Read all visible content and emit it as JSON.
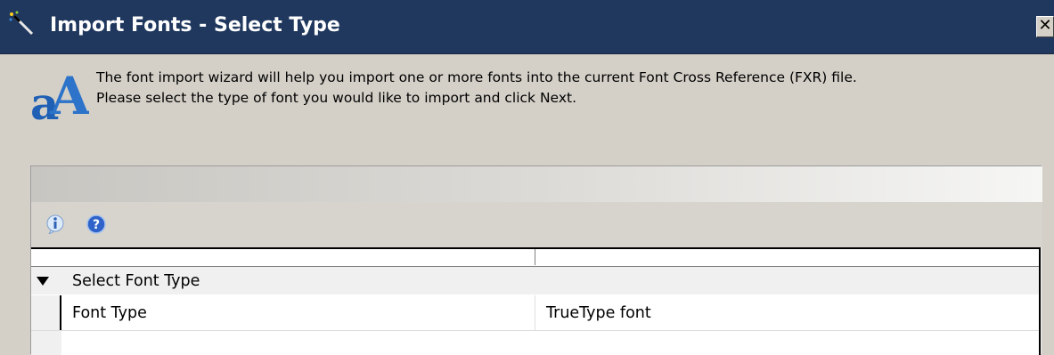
{
  "window": {
    "title": "Import Fonts - Select Type",
    "close_label": "✕",
    "title_icon": "wizard-wand-icon"
  },
  "intro": {
    "icon": "font-wizard-icon",
    "line1": "The font import wizard will help you import one or more fonts into the current Font Cross Reference (FXR) file.",
    "line2": "Please select the type of font you would like to import and click Next."
  },
  "toolbar": {
    "icons": [
      "info-icon",
      "help-icon"
    ]
  },
  "property_grid": {
    "category": {
      "label": "Select Font Type",
      "expanded": true
    },
    "properties": [
      {
        "name": "Font Type",
        "value": "TrueType font"
      }
    ]
  },
  "colors": {
    "titlebar": "#20385e",
    "dialog_bg": "#d4d0c8",
    "accent_blue": "#1f5fb4"
  }
}
